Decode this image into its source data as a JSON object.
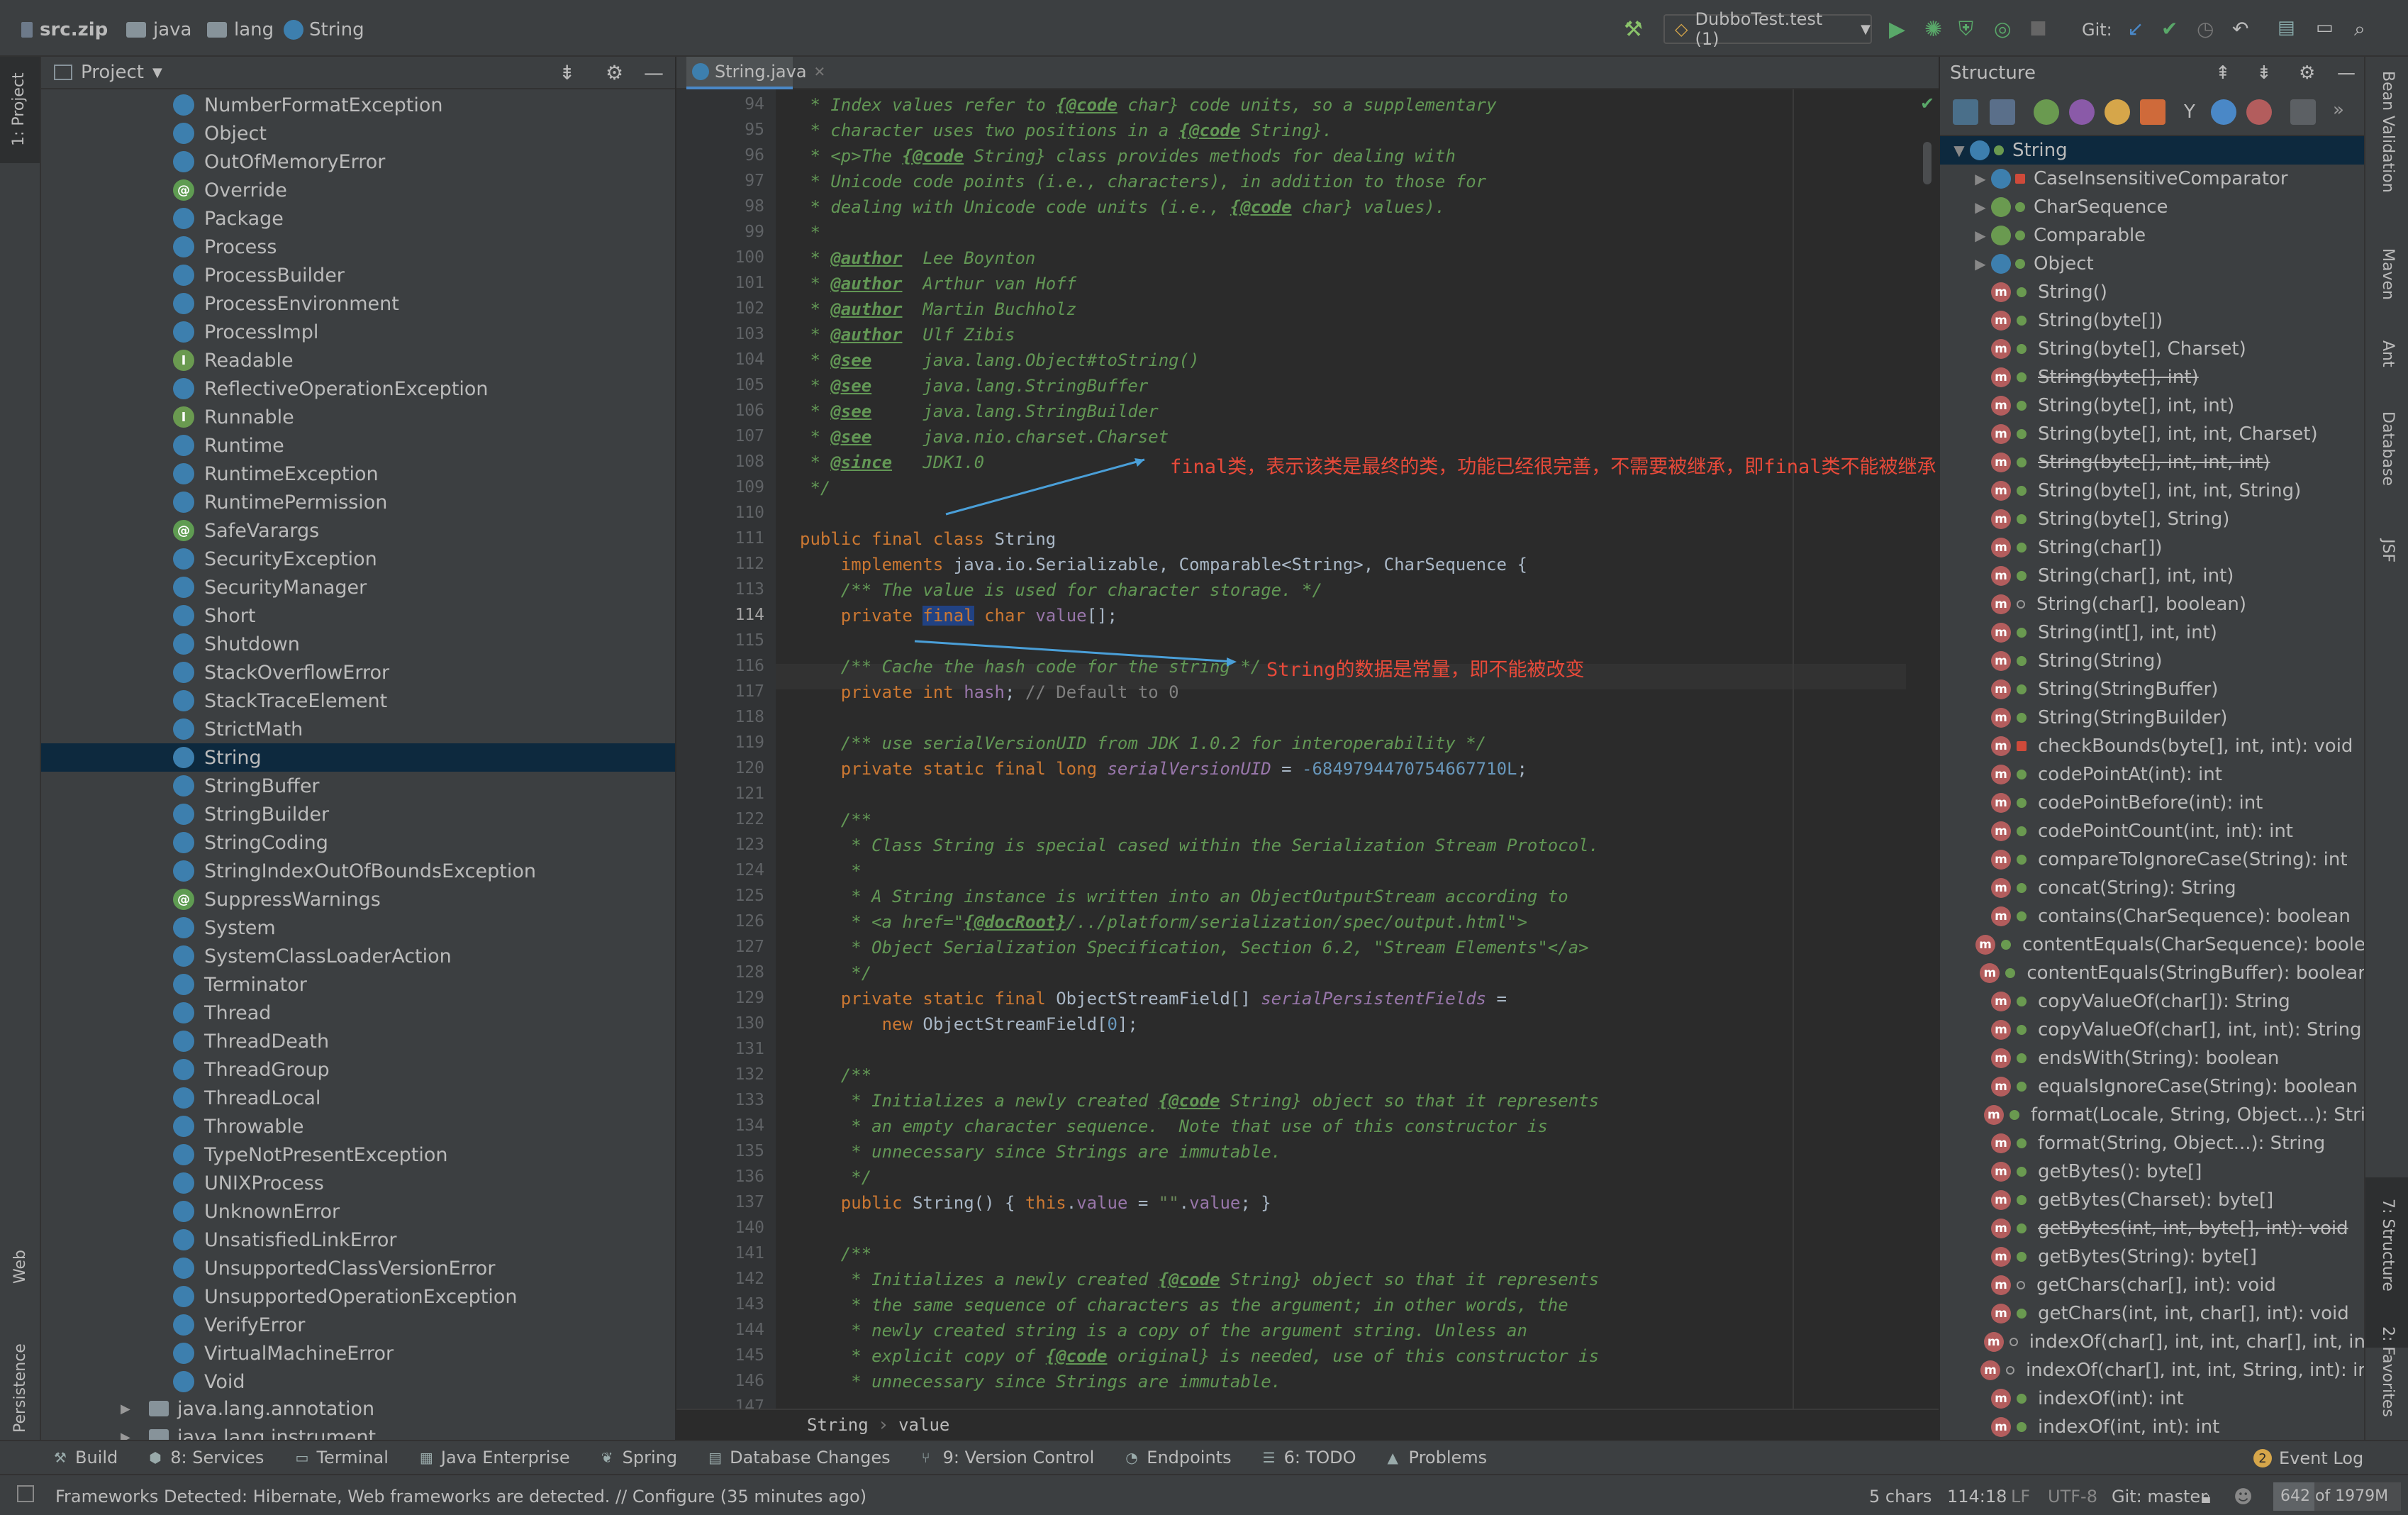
{
  "navbar": {
    "crumbs": [
      "src.zip",
      "java",
      "lang",
      "String"
    ],
    "run_config": "DubboTest.test (1)",
    "git_label": "Git:"
  },
  "left_stripe": {
    "project_tab": "1: Project",
    "web_tab": "Web",
    "persistence_tab": "Persistence"
  },
  "project": {
    "title": "Project",
    "items": [
      {
        "label": "NumberFormatException",
        "kind": "class"
      },
      {
        "label": "Object",
        "kind": "class"
      },
      {
        "label": "OutOfMemoryError",
        "kind": "class"
      },
      {
        "label": "Override",
        "kind": "annotation"
      },
      {
        "label": "Package",
        "kind": "class"
      },
      {
        "label": "Process",
        "kind": "class"
      },
      {
        "label": "ProcessBuilder",
        "kind": "class"
      },
      {
        "label": "ProcessEnvironment",
        "kind": "class"
      },
      {
        "label": "ProcessImpl",
        "kind": "class"
      },
      {
        "label": "Readable",
        "kind": "interface"
      },
      {
        "label": "ReflectiveOperationException",
        "kind": "class"
      },
      {
        "label": "Runnable",
        "kind": "interface"
      },
      {
        "label": "Runtime",
        "kind": "class"
      },
      {
        "label": "RuntimeException",
        "kind": "class"
      },
      {
        "label": "RuntimePermission",
        "kind": "class"
      },
      {
        "label": "SafeVarargs",
        "kind": "annotation"
      },
      {
        "label": "SecurityException",
        "kind": "class"
      },
      {
        "label": "SecurityManager",
        "kind": "class"
      },
      {
        "label": "Short",
        "kind": "class"
      },
      {
        "label": "Shutdown",
        "kind": "class"
      },
      {
        "label": "StackOverflowError",
        "kind": "class"
      },
      {
        "label": "StackTraceElement",
        "kind": "class"
      },
      {
        "label": "StrictMath",
        "kind": "class"
      },
      {
        "label": "String",
        "kind": "class",
        "selected": true
      },
      {
        "label": "StringBuffer",
        "kind": "class"
      },
      {
        "label": "StringBuilder",
        "kind": "class"
      },
      {
        "label": "StringCoding",
        "kind": "class"
      },
      {
        "label": "StringIndexOutOfBoundsException",
        "kind": "class"
      },
      {
        "label": "SuppressWarnings",
        "kind": "annotation"
      },
      {
        "label": "System",
        "kind": "class"
      },
      {
        "label": "SystemClassLoaderAction",
        "kind": "class"
      },
      {
        "label": "Terminator",
        "kind": "class"
      },
      {
        "label": "Thread",
        "kind": "class"
      },
      {
        "label": "ThreadDeath",
        "kind": "class"
      },
      {
        "label": "ThreadGroup",
        "kind": "class"
      },
      {
        "label": "ThreadLocal",
        "kind": "class"
      },
      {
        "label": "Throwable",
        "kind": "class"
      },
      {
        "label": "TypeNotPresentException",
        "kind": "class"
      },
      {
        "label": "UNIXProcess",
        "kind": "class"
      },
      {
        "label": "UnknownError",
        "kind": "class"
      },
      {
        "label": "UnsatisfiedLinkError",
        "kind": "class"
      },
      {
        "label": "UnsupportedClassVersionError",
        "kind": "class"
      },
      {
        "label": "UnsupportedOperationException",
        "kind": "class"
      },
      {
        "label": "VerifyError",
        "kind": "class"
      },
      {
        "label": "VirtualMachineError",
        "kind": "class"
      },
      {
        "label": "Void",
        "kind": "class"
      }
    ],
    "packages": [
      "java.lang.annotation",
      "java.lang.instrument"
    ]
  },
  "editor": {
    "tab": "String.java",
    "line_numbers": [
      "94",
      "95",
      "96",
      "97",
      "98",
      "99",
      "100",
      "101",
      "102",
      "103",
      "104",
      "105",
      "106",
      "107",
      "108",
      "109",
      "110",
      "111",
      "112",
      "113",
      "114",
      "115",
      "116",
      "117",
      "118",
      "119",
      "120",
      "121",
      "122",
      "123",
      "124",
      "125",
      "126",
      "127",
      "128",
      "129",
      "130",
      "131",
      "132",
      "133",
      "134",
      "135",
      "136",
      "137",
      "140",
      "141",
      "142",
      "143",
      "144",
      "145",
      "146",
      "147"
    ],
    "current_line": "114",
    "lines": [
      [
        [
          "cm",
          " * Index values refer to "
        ],
        [
          "tg",
          "{@code"
        ],
        [
          "cm",
          " char} code units, so a supplementary"
        ]
      ],
      [
        [
          "cm",
          " * character uses two positions in a "
        ],
        [
          "tg",
          "{@code"
        ],
        [
          "cm",
          " String}."
        ]
      ],
      [
        [
          "cm",
          " * <p>The "
        ],
        [
          "tg",
          "{@code"
        ],
        [
          "cm",
          " String} class provides methods for dealing with"
        ]
      ],
      [
        [
          "cm",
          " * Unicode code points (i.e., characters), in addition to those for"
        ]
      ],
      [
        [
          "cm",
          " * dealing with Unicode code units (i.e., "
        ],
        [
          "tg",
          "{@code"
        ],
        [
          "cm",
          " char} values)."
        ]
      ],
      [
        [
          "cm",
          " *"
        ]
      ],
      [
        [
          "cm",
          " * "
        ],
        [
          "tg",
          "@author"
        ],
        [
          "cm",
          "  Lee Boynton"
        ]
      ],
      [
        [
          "cm",
          " * "
        ],
        [
          "tg",
          "@author"
        ],
        [
          "cm",
          "  Arthur van Hoff"
        ]
      ],
      [
        [
          "cm",
          " * "
        ],
        [
          "tg",
          "@author"
        ],
        [
          "cm",
          "  Martin Buchholz"
        ]
      ],
      [
        [
          "cm",
          " * "
        ],
        [
          "tg",
          "@author"
        ],
        [
          "cm",
          "  Ulf Zibis"
        ]
      ],
      [
        [
          "cm",
          " * "
        ],
        [
          "tg",
          "@see"
        ],
        [
          "cm",
          "     java.lang.Object#toString()"
        ]
      ],
      [
        [
          "cm",
          " * "
        ],
        [
          "tg",
          "@see"
        ],
        [
          "cm",
          "     java.lang.StringBuffer"
        ]
      ],
      [
        [
          "cm",
          " * "
        ],
        [
          "tg",
          "@see"
        ],
        [
          "cm",
          "     java.lang.StringBuilder"
        ]
      ],
      [
        [
          "cm",
          " * "
        ],
        [
          "tg",
          "@see"
        ],
        [
          "cm",
          "     java.nio.charset.Charset"
        ]
      ],
      [
        [
          "cm",
          " * "
        ],
        [
          "tg",
          "@since"
        ],
        [
          "cm",
          "   JDK1.0"
        ]
      ],
      [
        [
          "cm",
          " */"
        ]
      ],
      [
        [
          "pl",
          ""
        ]
      ],
      [
        [
          "kw",
          "public final class "
        ],
        [
          "pl",
          "String"
        ]
      ],
      [
        [
          "pl",
          "    "
        ],
        [
          "kw",
          "implements "
        ],
        [
          "pl",
          "java.io.Serializable, Comparable<String>, CharSequence {"
        ]
      ],
      [
        [
          "pl",
          "    "
        ],
        [
          "cm",
          "/** The value is used for character storage. */"
        ]
      ],
      [
        [
          "pl",
          "    "
        ],
        [
          "kw",
          "private "
        ],
        [
          "hl",
          "final"
        ],
        [
          "kw",
          " char "
        ],
        [
          "fld",
          "value"
        ],
        [
          "pl",
          "[];"
        ]
      ],
      [
        [
          "pl",
          ""
        ]
      ],
      [
        [
          "pl",
          "    "
        ],
        [
          "cm",
          "/** Cache the hash code for the string */"
        ]
      ],
      [
        [
          "pl",
          "    "
        ],
        [
          "kw",
          "private int "
        ],
        [
          "fld",
          "hash"
        ],
        [
          "pl",
          "; "
        ],
        [
          "cmn",
          "// Default to 0"
        ]
      ],
      [
        [
          "pl",
          ""
        ]
      ],
      [
        [
          "pl",
          "    "
        ],
        [
          "cm",
          "/** use serialVersionUID from JDK 1.0.2 for interoperability */"
        ]
      ],
      [
        [
          "pl",
          "    "
        ],
        [
          "kw",
          "private static final long "
        ],
        [
          "sfld",
          "serialVersionUID"
        ],
        [
          "pl",
          " = "
        ],
        [
          "num",
          "-6849794470754667710L"
        ],
        [
          "pl",
          ";"
        ]
      ],
      [
        [
          "pl",
          ""
        ]
      ],
      [
        [
          "pl",
          "    "
        ],
        [
          "cm",
          "/**"
        ]
      ],
      [
        [
          "pl",
          "    "
        ],
        [
          "cm",
          " * Class String is special cased within the Serialization Stream Protocol."
        ]
      ],
      [
        [
          "pl",
          "    "
        ],
        [
          "cm",
          " *"
        ]
      ],
      [
        [
          "pl",
          "    "
        ],
        [
          "cm",
          " * A String instance is written into an ObjectOutputStream according to"
        ]
      ],
      [
        [
          "pl",
          "    "
        ],
        [
          "cm",
          " * <a href=\""
        ],
        [
          "tg",
          "{@docRoot}"
        ],
        [
          "cm",
          "/../platform/serialization/spec/output.html\">"
        ]
      ],
      [
        [
          "pl",
          "    "
        ],
        [
          "cm",
          " * Object Serialization Specification, Section 6.2, \"Stream Elements\"</a>"
        ]
      ],
      [
        [
          "pl",
          "    "
        ],
        [
          "cm",
          " */"
        ]
      ],
      [
        [
          "pl",
          "    "
        ],
        [
          "kw",
          "private static final "
        ],
        [
          "pl",
          "ObjectStreamField[] "
        ],
        [
          "sfld",
          "serialPersistentFields"
        ],
        [
          "pl",
          " ="
        ]
      ],
      [
        [
          "pl",
          "        "
        ],
        [
          "kw",
          "new "
        ],
        [
          "pl",
          "ObjectStreamField["
        ],
        [
          "num",
          "0"
        ],
        [
          "pl",
          "];"
        ]
      ],
      [
        [
          "pl",
          ""
        ]
      ],
      [
        [
          "pl",
          "    "
        ],
        [
          "cm",
          "/**"
        ]
      ],
      [
        [
          "pl",
          "    "
        ],
        [
          "cm",
          " * Initializes a newly created "
        ],
        [
          "tg",
          "{@code"
        ],
        [
          "cm",
          " String} object so that it represents"
        ]
      ],
      [
        [
          "pl",
          "    "
        ],
        [
          "cm",
          " * an empty character sequence.  Note that use of this constructor is"
        ]
      ],
      [
        [
          "pl",
          "    "
        ],
        [
          "cm",
          " * unnecessary since Strings are immutable."
        ]
      ],
      [
        [
          "pl",
          "    "
        ],
        [
          "cm",
          " */"
        ]
      ],
      [
        [
          "pl",
          "    "
        ],
        [
          "kw",
          "public "
        ],
        [
          "pl",
          "String() { "
        ],
        [
          "kw",
          "this"
        ],
        [
          "pl",
          "."
        ],
        [
          "fld",
          "value"
        ],
        [
          "pl",
          " = "
        ],
        [
          "str",
          "\"\""
        ],
        [
          "pl",
          "."
        ],
        [
          "fld",
          "value"
        ],
        [
          "pl",
          "; }"
        ]
      ],
      [
        [
          "pl",
          ""
        ]
      ],
      [
        [
          "pl",
          "    "
        ],
        [
          "cm",
          "/**"
        ]
      ],
      [
        [
          "pl",
          "    "
        ],
        [
          "cm",
          " * Initializes a newly created "
        ],
        [
          "tg",
          "{@code"
        ],
        [
          "cm",
          " String} object so that it represents"
        ]
      ],
      [
        [
          "pl",
          "    "
        ],
        [
          "cm",
          " * the same sequence of characters as the argument; in other words, the"
        ]
      ],
      [
        [
          "pl",
          "    "
        ],
        [
          "cm",
          " * newly created string is a copy of the argument string. Unless an"
        ]
      ],
      [
        [
          "pl",
          "    "
        ],
        [
          "cm",
          " * explicit copy of "
        ],
        [
          "tg",
          "{@code"
        ],
        [
          "cm",
          " original} is needed, use of this constructor is"
        ]
      ],
      [
        [
          "pl",
          "    "
        ],
        [
          "cm",
          " * unnecessary since Strings are immutable."
        ]
      ],
      [
        [
          "pl",
          ""
        ]
      ]
    ],
    "annotation_1": "final类，表示该类是最终的类，功能已经很完善，不需要被继承，即final类不能被继承",
    "annotation_2": "String的数据是常量，即不能被改变",
    "breadcrumb": [
      "String",
      "value"
    ]
  },
  "structure": {
    "title": "Structure",
    "root": "String",
    "nodes": [
      {
        "label": "CaseInsensitiveComparator",
        "kind": "class",
        "expand": true,
        "lock": true
      },
      {
        "label": "CharSequence",
        "kind": "iface",
        "expand": true
      },
      {
        "label": "Comparable",
        "kind": "iface",
        "expand": true
      },
      {
        "label": "Object",
        "kind": "class",
        "expand": true
      }
    ],
    "members": [
      {
        "label": "String()"
      },
      {
        "label": "String(byte[])"
      },
      {
        "label": "String(byte[], Charset)"
      },
      {
        "label": "String(byte[], int)",
        "strike": true
      },
      {
        "label": "String(byte[], int, int)"
      },
      {
        "label": "String(byte[], int, int, Charset)"
      },
      {
        "label": "String(byte[], int, int, int)",
        "strike": true
      },
      {
        "label": "String(byte[], int, int, String)"
      },
      {
        "label": "String(byte[], String)"
      },
      {
        "label": "String(char[])"
      },
      {
        "label": "String(char[], int, int)"
      },
      {
        "label": "String(char[], boolean)",
        "pkg": true
      },
      {
        "label": "String(int[], int, int)"
      },
      {
        "label": "String(String)"
      },
      {
        "label": "String(StringBuffer)"
      },
      {
        "label": "String(StringBuilder)"
      },
      {
        "label": "checkBounds(byte[], int, int): void",
        "lock": true
      },
      {
        "label": "codePointAt(int): int"
      },
      {
        "label": "codePointBefore(int): int"
      },
      {
        "label": "codePointCount(int, int): int"
      },
      {
        "label": "compareToIgnoreCase(String): int"
      },
      {
        "label": "concat(String): String"
      },
      {
        "label": "contains(CharSequence): boolean"
      },
      {
        "label": "contentEquals(CharSequence): boole"
      },
      {
        "label": "contentEquals(StringBuffer): boolear"
      },
      {
        "label": "copyValueOf(char[]): String"
      },
      {
        "label": "copyValueOf(char[], int, int): String"
      },
      {
        "label": "endsWith(String): boolean"
      },
      {
        "label": "equalsIgnoreCase(String): boolean"
      },
      {
        "label": "format(Locale, String, Object...): Stri"
      },
      {
        "label": "format(String, Object...): String"
      },
      {
        "label": "getBytes(): byte[]"
      },
      {
        "label": "getBytes(Charset): byte[]"
      },
      {
        "label": "getBytes(int, int, byte[], int): void",
        "strike": true
      },
      {
        "label": "getBytes(String): byte[]"
      },
      {
        "label": "getChars(char[], int): void",
        "pkg": true
      },
      {
        "label": "getChars(int, int, char[], int): void"
      },
      {
        "label": "indexOf(char[], int, int, char[], int, in",
        "pkg": true
      },
      {
        "label": "indexOf(char[], int, int, String, int): ir",
        "pkg": true
      },
      {
        "label": "indexOf(int): int"
      },
      {
        "label": "indexOf(int, int): int"
      }
    ]
  },
  "right_stripe": {
    "bean_validation": "Bean Validation",
    "maven": "Maven",
    "ant": "Ant",
    "database": "Database",
    "jsf": "JSF",
    "structure_tab": "7: Structure",
    "favorites": "2: Favorites"
  },
  "toolwindows": [
    "Build",
    "8: Services",
    "Terminal",
    "Java Enterprise",
    "Spring",
    "Database Changes",
    "9: Version Control",
    "Endpoints",
    "6: TODO",
    "Problems"
  ],
  "event_log": {
    "label": "Event Log",
    "count": "2"
  },
  "status": {
    "message": "Frameworks Detected: Hibernate, Web frameworks are detected. // Configure (35 minutes ago)",
    "chars": "5 chars",
    "position": "114:18",
    "line_sep": "LF",
    "encoding": "UTF-8",
    "git_branch": "Git: master",
    "memory": "642 of 1979M"
  },
  "colors": {
    "accent": "#4a88c7",
    "selection": "#0d293e",
    "annotation": "#e84a3a",
    "arrow": "#4a9fd8"
  }
}
